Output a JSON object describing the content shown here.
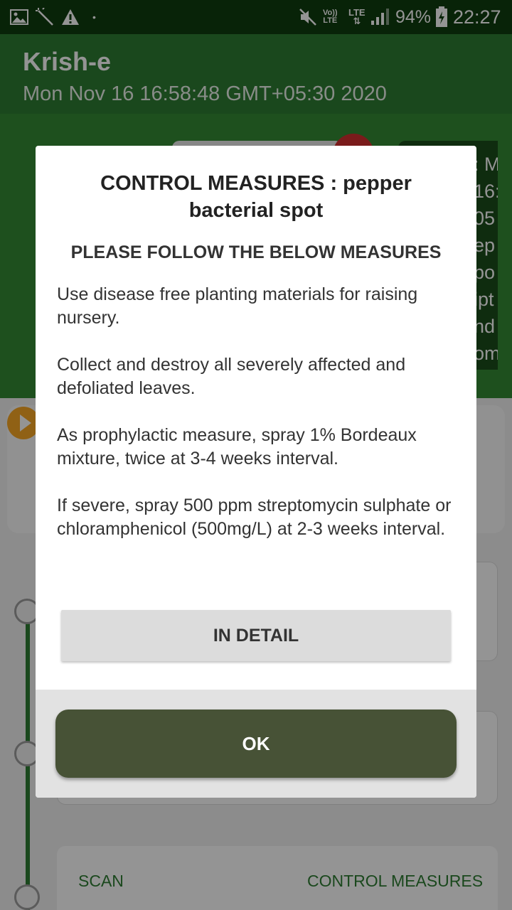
{
  "status_bar": {
    "icons": [
      "image-icon",
      "magic-wand-icon",
      "warning-icon",
      "mute-icon",
      "volte-icon",
      "signal-icon",
      "battery-charging-icon"
    ],
    "dot": "•",
    "volte_top": "Vo))",
    "volte_bottom": "LTE",
    "lte": "LTE",
    "battery": "94%",
    "time": "22:27"
  },
  "app_bar": {
    "title": "Krish-e",
    "subtitle": "Mon Nov 16 16:58:48 GMT+05:30 2020"
  },
  "background": {
    "right_panel_lines": [
      ": M",
      "16:",
      "05",
      "ep",
      "po",
      "ipt",
      "nd",
      "om"
    ],
    "scan_label": "SCAN",
    "control_measures_label": "CONTROL MEASURES"
  },
  "dialog": {
    "title": "CONTROL MEASURES : pepper bacterial spot",
    "subtitle": "PLEASE FOLLOW THE BELOW MEASURES",
    "body": "Use disease free planting materials for raising nursery.\n\n Collect and destroy all severely affected and defoliated leaves.\n\n As prophylactic measure, spray 1% Bordeaux mixture, twice at 3-4 weeks interval.\n\n If severe, spray 500 ppm streptomycin sulphate or chloramphenicol (500mg/L) at 2-3 weeks interval.",
    "detail_button": "IN DETAIL",
    "ok_button": "OK"
  },
  "colors": {
    "status_bar": "#0f3d0f",
    "app_bar": "#2e7d32",
    "ok_button": "#475236",
    "detail_button": "#dcdcdc"
  }
}
